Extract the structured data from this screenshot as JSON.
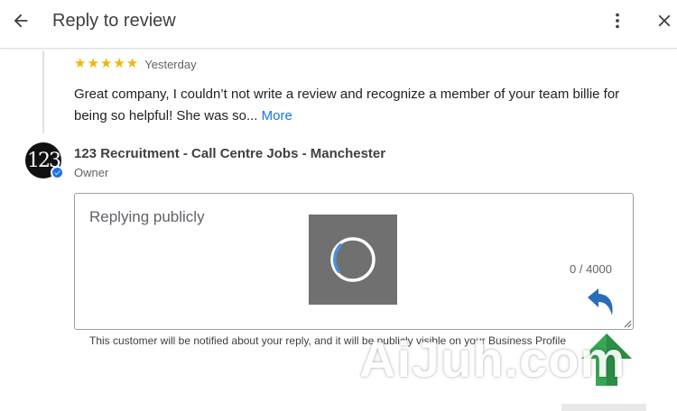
{
  "header": {
    "title": "Reply to review",
    "back_icon": "arrow-back-icon",
    "more_icon": "more-vert-icon",
    "close_icon": "close-icon"
  },
  "review": {
    "stars": "★★★★★",
    "rating": 5,
    "date": "Yesterday",
    "text": "Great company, I couldn’t not write a review and recognize a member of your team billie for being so helpful! She was so...",
    "more_label": "More"
  },
  "owner": {
    "avatar_text": "123",
    "name": "123 Recruitment - Call Centre Jobs - Manchester",
    "role": "Owner"
  },
  "reply": {
    "placeholder": "Replying publicly",
    "char_count": "0 / 4000"
  },
  "notice": "This customer will be notified about your reply, and it will be publicly visible on your Business Profile",
  "watermark": "AiJuh.com",
  "colors": {
    "accent": "#1a73e8",
    "star": "#f4b400",
    "arrow_green": "#34a853"
  }
}
